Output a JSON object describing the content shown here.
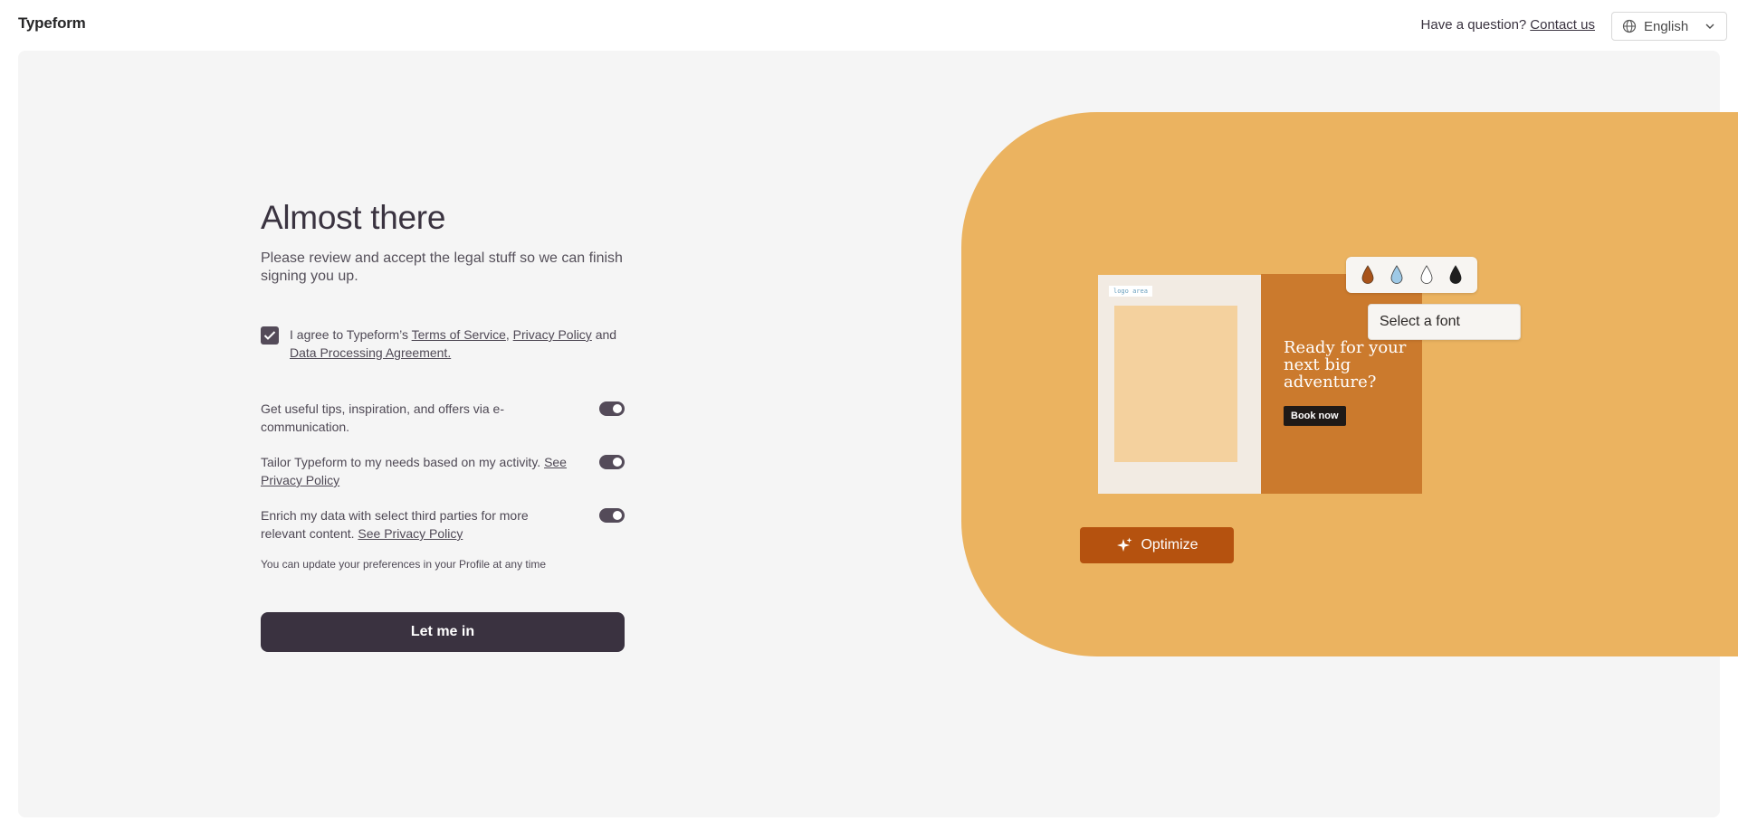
{
  "header": {
    "brand": "Typeform",
    "question_text": "Have a question?",
    "contact_link": "Contact us",
    "language": "English"
  },
  "form": {
    "title": "Almost there",
    "subtitle": "Please review and accept the legal stuff so we can finish signing you up.",
    "consent": {
      "checked": true,
      "prefix": "I agree to Typeform’s",
      "terms_link": "Terms of Service",
      "separator": ",",
      "privacy_link": "Privacy Policy",
      "and": "and",
      "dpa_link": "Data Processing Agreement."
    },
    "preferences": [
      {
        "text": "Get useful tips, inspiration, and offers via e-communication.",
        "link": "",
        "enabled": true
      },
      {
        "text": "Tailor Typeform to my needs based on my activity.",
        "link": "See Privacy Policy",
        "enabled": true
      },
      {
        "text": "Enrich my data with select third parties for more relevant content.",
        "link": "See Privacy Policy",
        "enabled": true
      }
    ],
    "footnote": "You can update your preferences in your Profile at any time",
    "submit_label": "Let me in"
  },
  "illustration": {
    "logo_area": "logo area",
    "headline": "Ready for your next big adventure?",
    "cta": "Book now",
    "font_select": "Select a font",
    "optimize_label": "Optimize",
    "drop_colors": [
      "#a8531a",
      "#9ec9e6",
      "#ffffff",
      "#1f1f1f"
    ],
    "blob_color": "#ebb360"
  }
}
